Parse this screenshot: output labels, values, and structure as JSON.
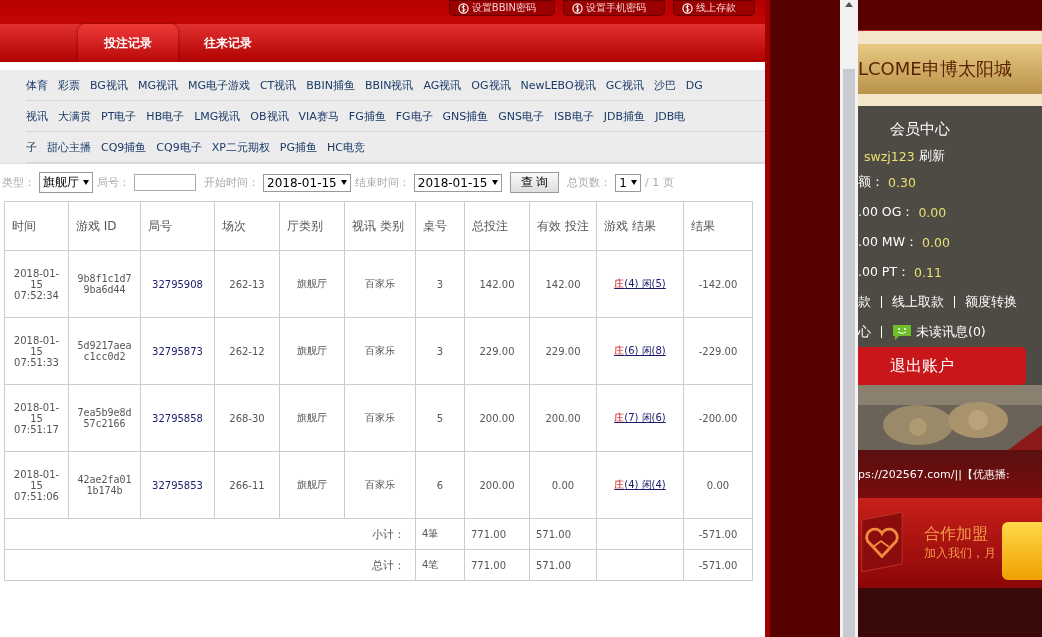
{
  "top_buttons": [
    {
      "label": "设置BBIN密码"
    },
    {
      "label": "设置手机密码"
    },
    {
      "label": "线上存款"
    }
  ],
  "tabs": [
    {
      "label": "投注记录",
      "selected": true
    },
    {
      "label": "往来记录",
      "selected": false
    }
  ],
  "game_nav": [
    {
      "items": [
        "体育",
        "彩票",
        "BG视讯",
        "MG视讯",
        "MG电子游戏",
        "CT视讯",
        "BBIN捕鱼",
        "BBIN视讯",
        "AG视讯",
        "OG视讯",
        "NewLEBO视讯",
        "GC视讯",
        "沙巴",
        "DG"
      ]
    },
    {
      "items": [
        "视讯",
        "大满贯",
        "PT电子",
        "HB电子",
        "LMG视讯",
        "OB视讯",
        "VIA赛马",
        "FG捕鱼",
        "FG电子",
        "GNS捕鱼",
        "GNS电子",
        "ISB电子",
        "JDB捕鱼",
        "JDB电"
      ]
    },
    {
      "items": [
        "子",
        "甜心主播",
        "CQ9捕鱼",
        "CQ9电子",
        "XP二元期权",
        "PG捕鱼",
        "HC电竞"
      ]
    }
  ],
  "filters": {
    "type_label": "类型：",
    "type_value": "旗舰厅",
    "round_label": "局号：",
    "start_label": "开始时间：",
    "start_value": "2018-01-15",
    "end_label": "结束时间：",
    "end_value": "2018-01-15",
    "query_button": "查 询",
    "pages_label": "总页数：",
    "page_value": "1",
    "page_total": "/ 1 页"
  },
  "table": {
    "columns": [
      "时间",
      "游戏 ID",
      "局号",
      "场次",
      "厅类别",
      "视讯 类别",
      "桌号",
      "总投注",
      "有效 投注",
      "游戏 结果",
      "结果"
    ],
    "rows": [
      {
        "time": "2018-01- 15 07:52:34",
        "game_id": "9b8f1c1d7 9ba6d44",
        "round": "32795908",
        "session": "262-13",
        "hall": "旗舰厅",
        "video_type": "百家乐",
        "table_no": "3",
        "total_bet": "142.00",
        "valid_bet": "142.00",
        "banker": "庄",
        "banker_points": "(4)",
        "player": "闲(5)",
        "result": "-142.00"
      },
      {
        "time": "2018-01- 15 07:51:33",
        "game_id": "5d9217aea c1cc0d2",
        "round": "32795873",
        "session": "262-12",
        "hall": "旗舰厅",
        "video_type": "百家乐",
        "table_no": "3",
        "total_bet": "229.00",
        "valid_bet": "229.00",
        "banker": "庄",
        "banker_points": "(6)",
        "player": "闲(8)",
        "result": "-229.00"
      },
      {
        "time": "2018-01- 15 07:51:17",
        "game_id": "7ea5b9e8d 57c2166",
        "round": "32795858",
        "session": "268-30",
        "hall": "旗舰厅",
        "video_type": "百家乐",
        "table_no": "5",
        "total_bet": "200.00",
        "valid_bet": "200.00",
        "banker": "庄",
        "banker_points": "(7)",
        "player": "闲(6)",
        "result": "-200.00"
      },
      {
        "time": "2018-01- 15 07:51:06",
        "game_id": "42ae2fa01 1b174b",
        "round": "32795853",
        "session": "266-11",
        "hall": "旗舰厅",
        "video_type": "百家乐",
        "table_no": "6",
        "total_bet": "200.00",
        "valid_bet": "0.00",
        "banker": "庄",
        "banker_points": "(4)",
        "player": "闲(4)",
        "result": "0.00"
      }
    ],
    "summary": [
      {
        "label": "小计：",
        "count": "4筆",
        "total_bet": "771.00",
        "valid_bet": "571.00",
        "result": "-571.00"
      },
      {
        "label": "总计：",
        "count": "4笔",
        "total_bet": "771.00",
        "valid_bet": "571.00",
        "result": "-571.00"
      }
    ]
  },
  "side": {
    "banner": "LCOME申博太阳城",
    "title": "会员中心",
    "user": "swzj123",
    "refresh": "刷新",
    "balances": [
      {
        "label": "额：",
        "value": "0.30"
      },
      {
        "label": ".00 OG：",
        "value": "0.00"
      },
      {
        "label": ".00 MW：",
        "value": "0.00"
      },
      {
        "label": ".00 PT：",
        "value": "0.11"
      }
    ],
    "links": [
      "款",
      "线上取款",
      "额度转换"
    ],
    "links2": [
      "心"
    ],
    "messages": "未读讯息(0)",
    "logout": "退出账户",
    "ticker": "ps://202567.com/||【优惠播:",
    "join_title": "合作加盟",
    "join_sub": "加入我们，月"
  }
}
